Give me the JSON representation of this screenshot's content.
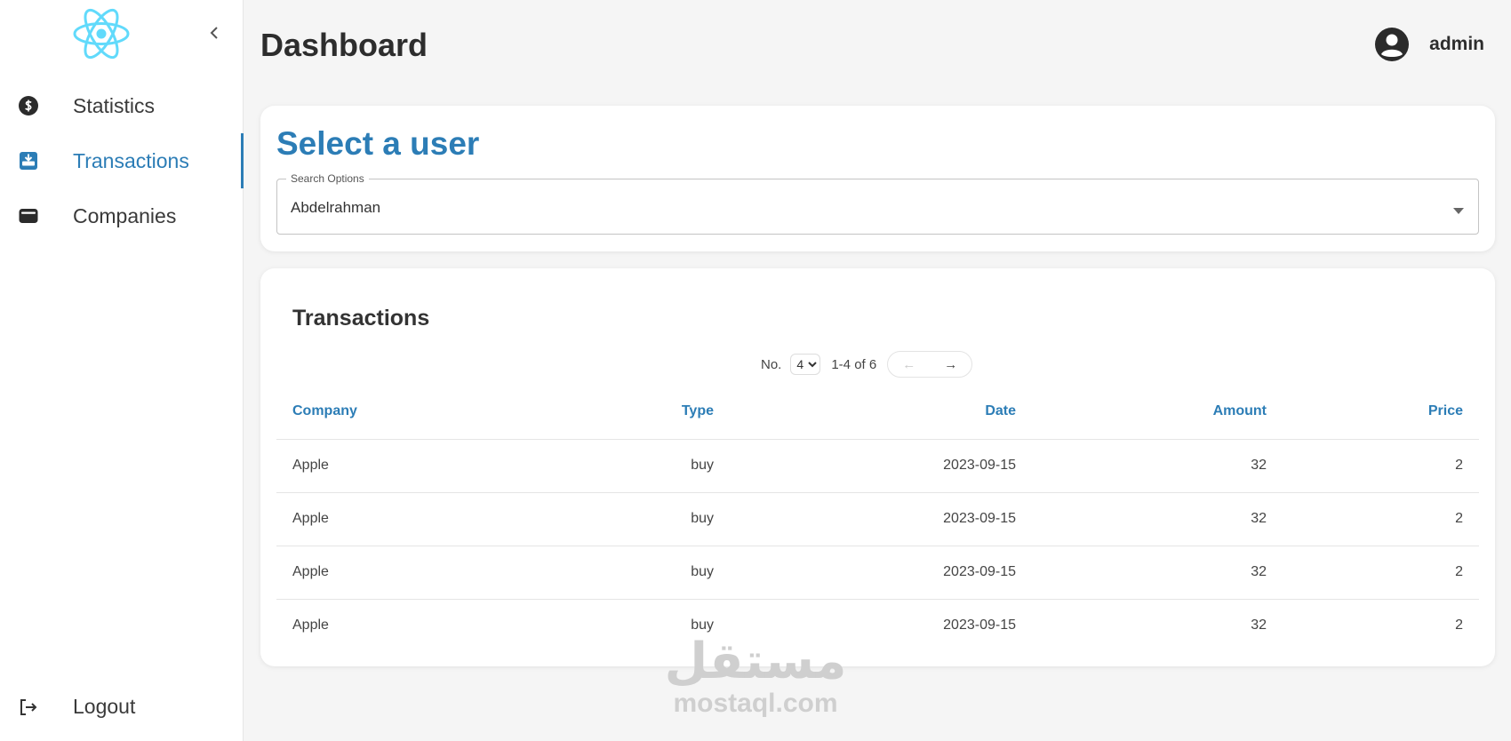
{
  "sidebar": {
    "items": [
      {
        "label": "Statistics",
        "icon": "dollar-circle-icon"
      },
      {
        "label": "Transactions",
        "icon": "inbox-download-icon",
        "active": true
      },
      {
        "label": "Companies",
        "icon": "wallet-icon"
      }
    ],
    "logout_label": "Logout"
  },
  "header": {
    "title": "Dashboard",
    "username": "admin"
  },
  "select_user": {
    "title": "Select a user",
    "legend": "Search Options",
    "value": "Abdelrahman"
  },
  "transactions": {
    "title": "Transactions",
    "pager": {
      "no_label": "No.",
      "page_size": "4",
      "range": "1-4 of 6",
      "prev": "←",
      "next": "→"
    },
    "columns": [
      "Company",
      "Type",
      "Date",
      "Amount",
      "Price"
    ],
    "rows": [
      [
        "Apple",
        "buy",
        "2023-09-15",
        "32",
        "2"
      ],
      [
        "Apple",
        "buy",
        "2023-09-15",
        "32",
        "2"
      ],
      [
        "Apple",
        "buy",
        "2023-09-15",
        "32",
        "2"
      ],
      [
        "Apple",
        "buy",
        "2023-09-15",
        "32",
        "2"
      ]
    ]
  },
  "watermark": {
    "arabic": "مستقل",
    "latin": "mostaql.com"
  },
  "colors": {
    "accent": "#2c7db6",
    "logo": "#61dafb"
  }
}
